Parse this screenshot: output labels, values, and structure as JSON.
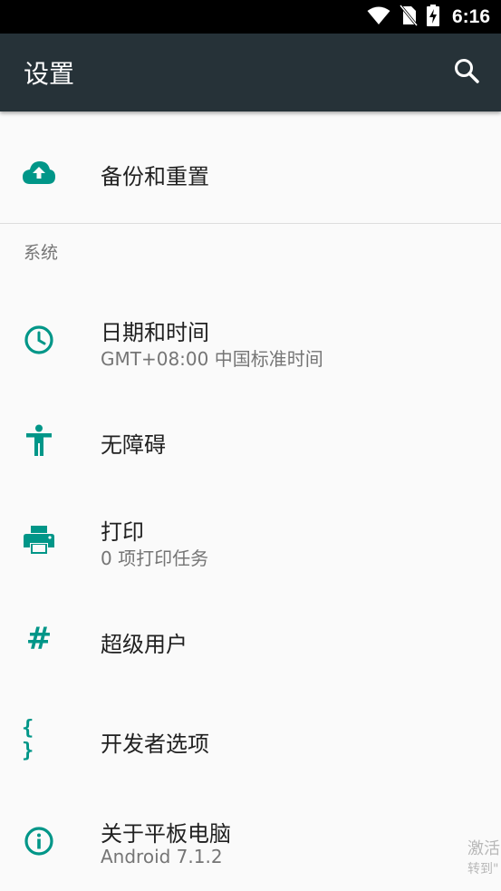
{
  "status_bar": {
    "time": "6:16",
    "icons": [
      "wifi-icon",
      "no-sim-icon",
      "battery-charging-icon"
    ]
  },
  "app_bar": {
    "title": "设置",
    "search_icon": "search-icon"
  },
  "items": {
    "backup": {
      "title": "备份和重置",
      "icon": "cloud-upload-icon"
    },
    "section_system": "系统",
    "date_time": {
      "title": "日期和时间",
      "subtitle": "GMT+08:00 中国标准时间",
      "icon": "clock-icon"
    },
    "accessibility": {
      "title": "无障碍",
      "icon": "accessibility-icon"
    },
    "print": {
      "title": "打印",
      "subtitle": "0 项打印任务",
      "icon": "printer-icon"
    },
    "superuser": {
      "title": "超级用户",
      "icon_glyph": "#",
      "icon": "hash-icon"
    },
    "developer": {
      "title": "开发者选项",
      "icon_glyph": "{ }",
      "icon": "braces-icon"
    },
    "about": {
      "title": "关于平板电脑",
      "subtitle": "Android 7.1.2",
      "icon": "info-icon"
    }
  },
  "watermark": {
    "line1": "激活",
    "line2": "转到\""
  },
  "colors": {
    "accent": "#009688",
    "app_bar": "#263238",
    "status_bar": "#000000",
    "background": "#fafafa"
  }
}
